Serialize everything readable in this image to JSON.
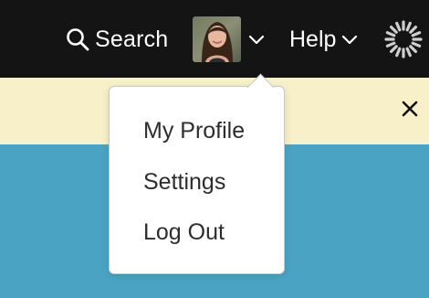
{
  "colors": {
    "topbar_bg": "#141414",
    "banner_bg": "#f8f0c8",
    "main_bg": "#4ba3c4",
    "text_light": "#ffffff",
    "text_dark": "#2d2d2d"
  },
  "header": {
    "search_label": "Search",
    "search_icon": "search-icon",
    "avatar_icon": "user-avatar",
    "help_label": "Help",
    "logo_icon": "brand-logo-icon"
  },
  "banner": {
    "close_icon": "close-icon"
  },
  "user_menu": {
    "items": [
      {
        "label": "My Profile"
      },
      {
        "label": "Settings"
      },
      {
        "label": "Log Out"
      }
    ]
  }
}
